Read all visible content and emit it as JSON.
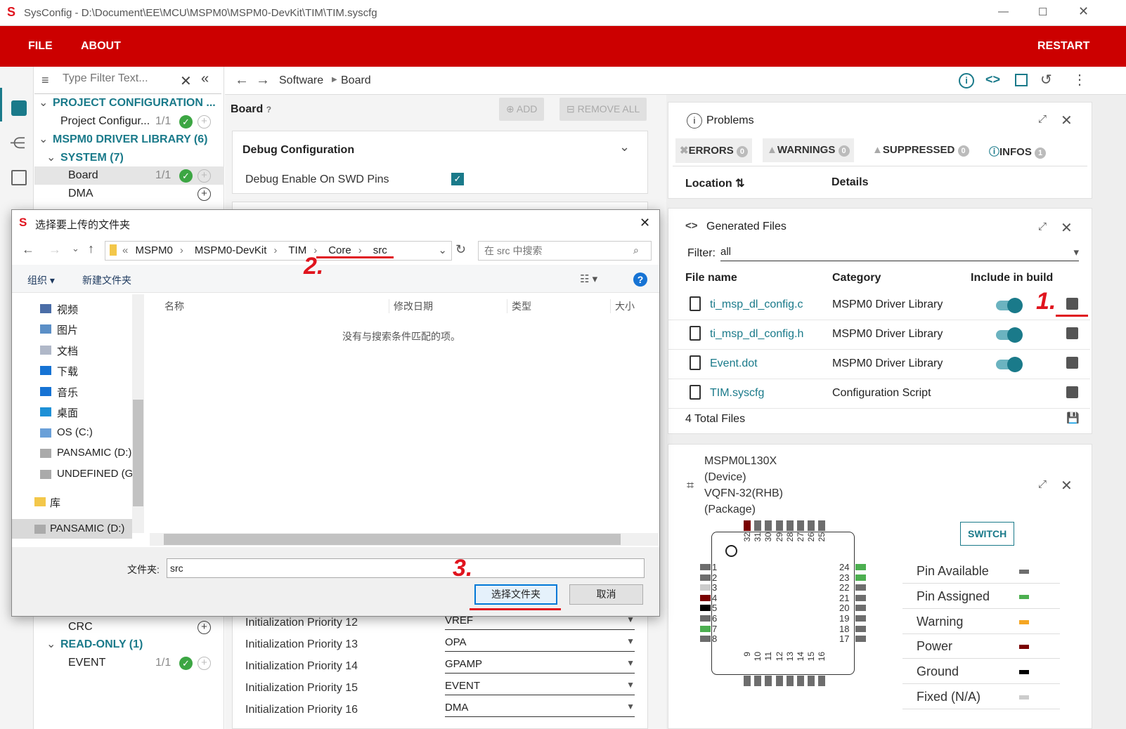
{
  "window": {
    "title": "SysConfig - D:\\Document\\EE\\MCU\\MSPM0\\MSPM0-DevKit\\TIM\\TIM.syscfg"
  },
  "menu": {
    "file": "FILE",
    "about": "ABOUT",
    "restart": "RESTART"
  },
  "sidebar": {
    "filter_placeholder": "Type Filter Text...",
    "items": [
      {
        "label": "PROJECT CONFIGURATION ...",
        "type": "group"
      },
      {
        "label": "Project Configur...",
        "count": "1/1"
      },
      {
        "label": "MSPM0 DRIVER LIBRARY (6)",
        "type": "group"
      },
      {
        "label": "SYSTEM (7)",
        "type": "group"
      },
      {
        "label": "Board",
        "count": "1/1"
      },
      {
        "label": "DMA"
      },
      {
        "label": "CRC"
      },
      {
        "label": "READ-ONLY (1)",
        "type": "group"
      },
      {
        "label": "EVENT",
        "count": "1/1"
      }
    ]
  },
  "breadcrumb": [
    "Software",
    "Board"
  ],
  "board": {
    "title": "Board",
    "add": "ADD",
    "remove_all": "REMOVE ALL",
    "section": "Debug Configuration",
    "debug_label": "Debug Enable On SWD Pins",
    "debug_checked": true,
    "priorities": [
      {
        "label": "Initialization Priority 12",
        "value": "VREF"
      },
      {
        "label": "Initialization Priority 13",
        "value": "OPA"
      },
      {
        "label": "Initialization Priority 14",
        "value": "GPAMP"
      },
      {
        "label": "Initialization Priority 15",
        "value": "EVENT"
      },
      {
        "label": "Initialization Priority 16",
        "value": "DMA"
      }
    ]
  },
  "problems": {
    "title": "Problems",
    "tabs": [
      {
        "label": "ERRORS",
        "count": "0"
      },
      {
        "label": "WARNINGS",
        "count": "0"
      },
      {
        "label": "SUPPRESSED",
        "count": "0"
      },
      {
        "label": "INFOS",
        "count": "1"
      }
    ],
    "col_location": "Location",
    "col_details": "Details"
  },
  "generated": {
    "title": "Generated Files",
    "filter_label": "Filter:",
    "filter_value": "all",
    "col_file": "File name",
    "col_category": "Category",
    "col_include": "Include in build",
    "files": [
      {
        "name": "ti_msp_dl_config.c",
        "category": "MSPM0 Driver Library",
        "include": true
      },
      {
        "name": "ti_msp_dl_config.h",
        "category": "MSPM0 Driver Library",
        "include": true
      },
      {
        "name": "Event.dot",
        "category": "MSPM0 Driver Library",
        "include": true
      },
      {
        "name": "TIM.syscfg",
        "category": "Configuration Script",
        "include": false
      }
    ],
    "total": "4 Total Files"
  },
  "device": {
    "line1": "MSPM0L130X",
    "line2": "(Device)",
    "line3": "VQFN-32(RHB)",
    "line4": "(Package)",
    "switch": "SWITCH",
    "legend": [
      {
        "label": "Pin Available",
        "color": "#6d6d6d"
      },
      {
        "label": "Pin Assigned",
        "color": "#4caf50"
      },
      {
        "label": "Warning",
        "color": "#f5a623"
      },
      {
        "label": "Power",
        "color": "#7a0000"
      },
      {
        "label": "Ground",
        "color": "#000000"
      },
      {
        "label": "Fixed (N/A)",
        "color": "#cccccc"
      }
    ],
    "pins": {
      "top": [
        "32",
        "31",
        "30",
        "29",
        "28",
        "27",
        "26",
        "25"
      ],
      "left": [
        "1",
        "2",
        "3",
        "4",
        "5",
        "6",
        "7",
        "8"
      ],
      "right": [
        "24",
        "23",
        "22",
        "21",
        "20",
        "19",
        "18",
        "17"
      ],
      "bottom": [
        "9",
        "10",
        "11",
        "12",
        "13",
        "14",
        "15",
        "16"
      ]
    }
  },
  "dialog": {
    "title": "选择要上传的文件夹",
    "path": [
      "MSPM0",
      "MSPM0-DevKit",
      "TIM",
      "Core",
      "src"
    ],
    "search_placeholder": "在 src 中搜索",
    "organize": "组织 ▾",
    "new_folder": "新建文件夹",
    "tree": [
      "视频",
      "图片",
      "文档",
      "下载",
      "音乐",
      "桌面",
      "OS (C:)",
      "PANSAMIC (D:)",
      "UNDEFINED (G:",
      "库",
      "PANSAMIC (D:)"
    ],
    "columns": [
      "名称",
      "修改日期",
      "类型",
      "大小"
    ],
    "empty": "没有与搜索条件匹配的项。",
    "folder_label": "文件夹:",
    "folder_value": "src",
    "select": "选择文件夹",
    "cancel": "取消"
  },
  "annotations": [
    "1.",
    "2.",
    "3."
  ]
}
